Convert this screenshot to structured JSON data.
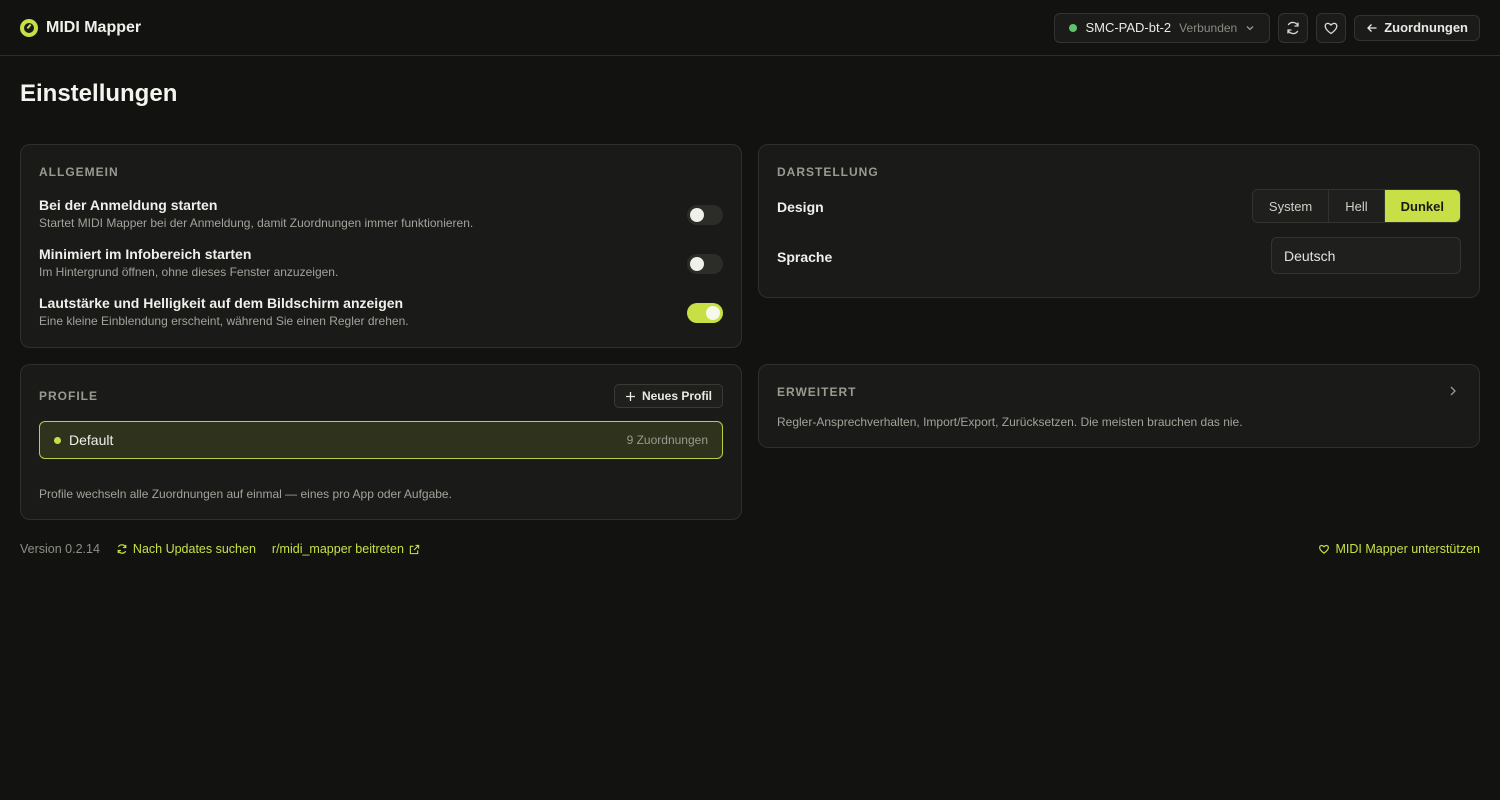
{
  "app": {
    "name": "MIDI Mapper"
  },
  "header": {
    "device_name": "SMC-PAD-bt-2",
    "device_status": "Verbunden",
    "back_label": "Zuordnungen"
  },
  "page": {
    "title": "Einstellungen"
  },
  "general": {
    "label": "ALLGEMEIN",
    "settings": [
      {
        "title": "Bei der Anmeldung starten",
        "desc": "Startet MIDI Mapper bei der Anmeldung, damit Zuordnungen immer funktionieren.",
        "enabled": false
      },
      {
        "title": "Minimiert im Infobereich starten",
        "desc": "Im Hintergrund öffnen, ohne dieses Fenster anzuzeigen.",
        "enabled": false
      },
      {
        "title": "Lautstärke und Helligkeit auf dem Bildschirm anzeigen",
        "desc": "Eine kleine Einblendung erscheint, während Sie einen Regler drehen.",
        "enabled": true
      }
    ]
  },
  "display": {
    "label": "DARSTELLUNG",
    "design_label": "Design",
    "design_options": [
      "System",
      "Hell",
      "Dunkel"
    ],
    "design_selected": "Dunkel",
    "language_label": "Sprache",
    "language_value": "Deutsch"
  },
  "profiles": {
    "label": "PROFILE",
    "new_button": "Neues Profil",
    "items": [
      {
        "name": "Default",
        "count": "9 Zuordnungen",
        "active": true
      }
    ],
    "note": "Profile wechseln alle Zuordnungen auf einmal — eines pro App oder Aufgabe."
  },
  "advanced": {
    "label": "ERWEITERT",
    "desc": "Regler-Ansprechverhalten, Import/Export, Zurücksetzen. Die meisten brauchen das nie."
  },
  "footer": {
    "version": "Version 0.2.14",
    "check_updates": "Nach Updates suchen",
    "community": "r/midi_mapper beitreten",
    "support": "MIDI Mapper unterstützen"
  },
  "colors": {
    "accent": "#c8e046",
    "background": "#121211",
    "card": "#1a1a18",
    "connected": "#5ec26a"
  }
}
